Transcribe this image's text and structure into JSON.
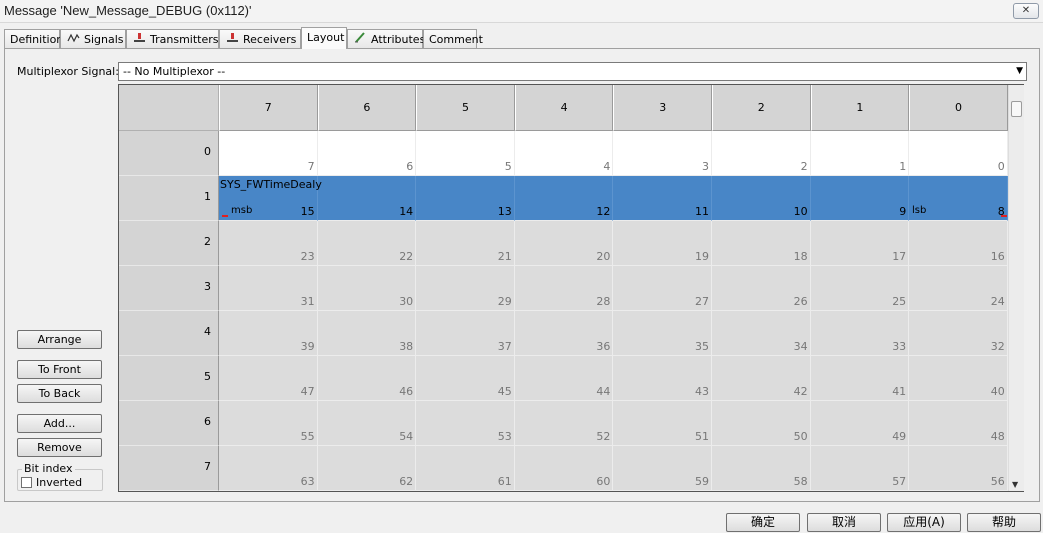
{
  "window": {
    "title": "Message 'New_Message_DEBUG (0x112)'",
    "close_glyph": "✕"
  },
  "tabs": [
    {
      "label": "Definition",
      "icon": ""
    },
    {
      "label": "Signals",
      "icon": "signals-icon"
    },
    {
      "label": "Transmitters",
      "icon": "transmitter-icon"
    },
    {
      "label": "Receivers",
      "icon": "receiver-icon"
    },
    {
      "label": "Layout",
      "icon": "",
      "active": true
    },
    {
      "label": "Attributes",
      "icon": "attributes-icon"
    },
    {
      "label": "Comment",
      "icon": ""
    }
  ],
  "multiplexor": {
    "label": "Multiplexor Signal:",
    "value": "-- No Multiplexor --"
  },
  "grid": {
    "col_headers": [
      "7",
      "6",
      "5",
      "4",
      "3",
      "2",
      "1",
      "0"
    ],
    "row_headers": [
      "0",
      "1",
      "2",
      "3",
      "4",
      "5",
      "6",
      "7"
    ],
    "bits": [
      [
        "7",
        "6",
        "5",
        "4",
        "3",
        "2",
        "1",
        "0"
      ],
      [
        "15",
        "14",
        "13",
        "12",
        "11",
        "10",
        "9",
        "8"
      ],
      [
        "23",
        "22",
        "21",
        "20",
        "19",
        "18",
        "17",
        "16"
      ],
      [
        "31",
        "30",
        "29",
        "28",
        "27",
        "26",
        "25",
        "24"
      ],
      [
        "39",
        "38",
        "37",
        "36",
        "35",
        "34",
        "33",
        "32"
      ],
      [
        "47",
        "46",
        "45",
        "44",
        "43",
        "42",
        "41",
        "40"
      ],
      [
        "55",
        "54",
        "53",
        "52",
        "51",
        "50",
        "49",
        "48"
      ],
      [
        "63",
        "62",
        "61",
        "60",
        "59",
        "58",
        "57",
        "56"
      ]
    ],
    "signal": {
      "name": "SYS_FWTimeDealy",
      "msb_label": "msb",
      "lsb_label": "lsb",
      "row": 1,
      "color": "#4886c7"
    }
  },
  "left_buttons": {
    "arrange": "Arrange",
    "to_front": "To Front",
    "to_back": "To Back",
    "add": "Add...",
    "remove": "Remove"
  },
  "bit_index": {
    "group_label": "Bit index",
    "inverted_label": "Inverted",
    "inverted_checked": false
  },
  "bottom_buttons": {
    "ok": "确定",
    "cancel": "取消",
    "apply": "应用(A)",
    "help": "帮助"
  }
}
